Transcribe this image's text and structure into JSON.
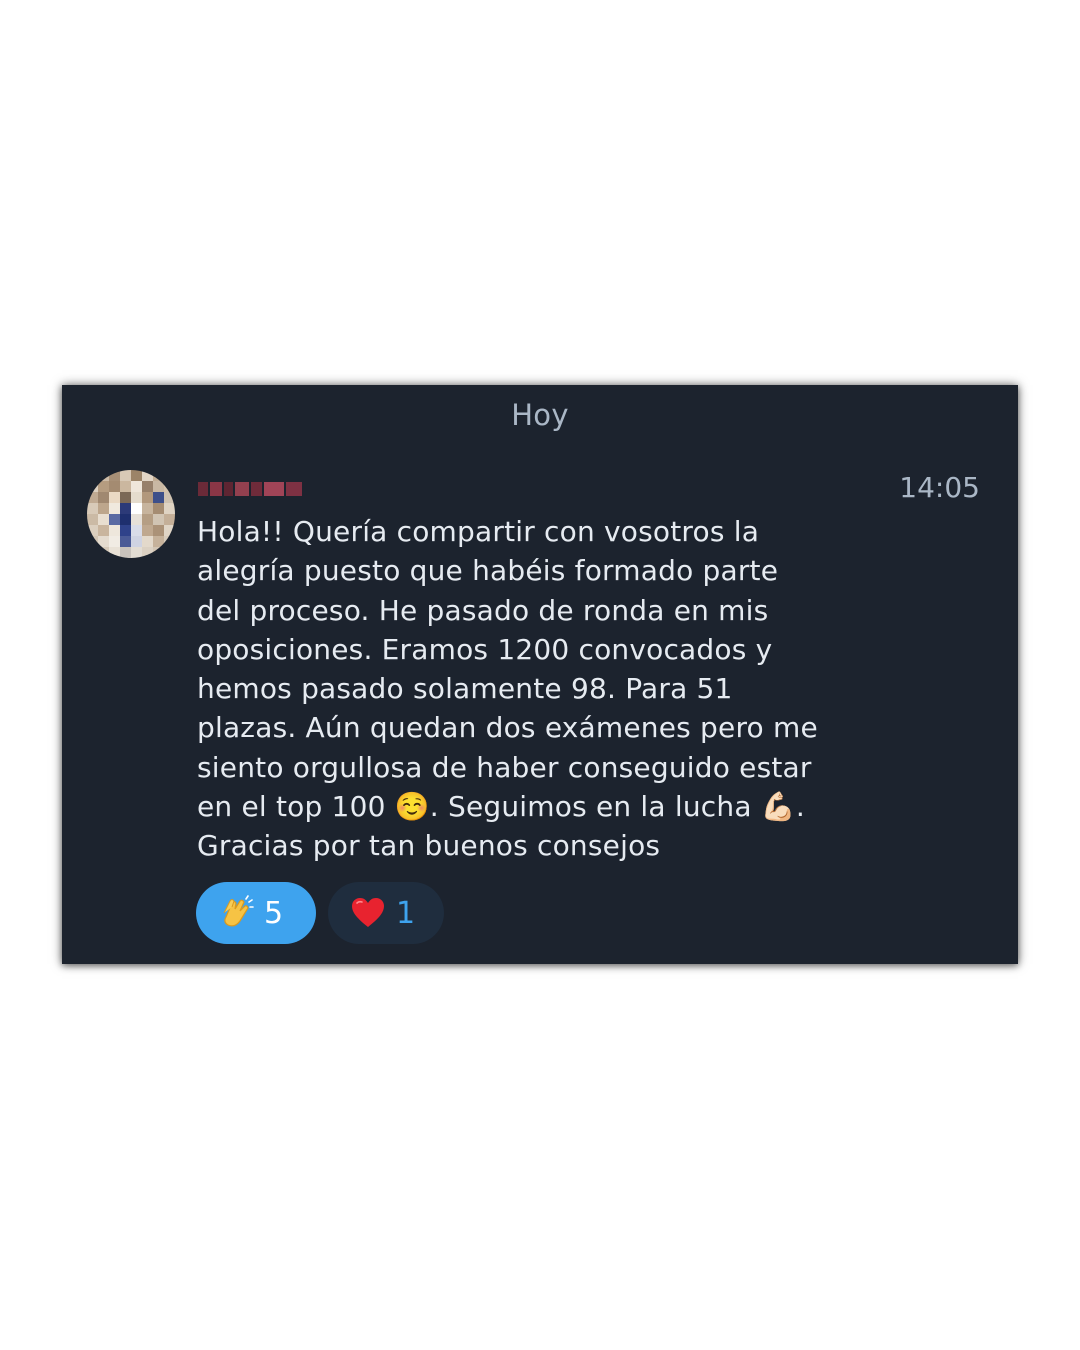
{
  "date_divider": "Hoy",
  "message": {
    "sender_name": "",
    "timestamp": "14:05",
    "text": "Hola!! Quería compartir con vosotros la\nalegría puesto que habéis formado parte\ndel proceso. He pasado de ronda en mis\noposiciones. Eramos 1200 convocados y\nhemos pasado solamente 98. Para 51\nplazas. Aún quedan dos exámenes pero me\nsiento orgullosa de haber conseguido estar\nen el top 100 ☺️. Seguimos en la lucha 💪🏻.\nGracias por tan buenos consejos"
  },
  "reactions": [
    {
      "emoji": "clapping-hands-icon",
      "count": "5",
      "selected": true
    },
    {
      "emoji": "red-heart-icon",
      "count": "1",
      "selected": false
    }
  ],
  "colors": {
    "panel_background": "#1c232e",
    "primary_text": "#e6ebf1",
    "secondary_text": "#aab7c6",
    "accent_blue": "#3ea3ee",
    "inactive_reaction_bg": "#1f2d3e",
    "page_background": "#ffffff"
  }
}
